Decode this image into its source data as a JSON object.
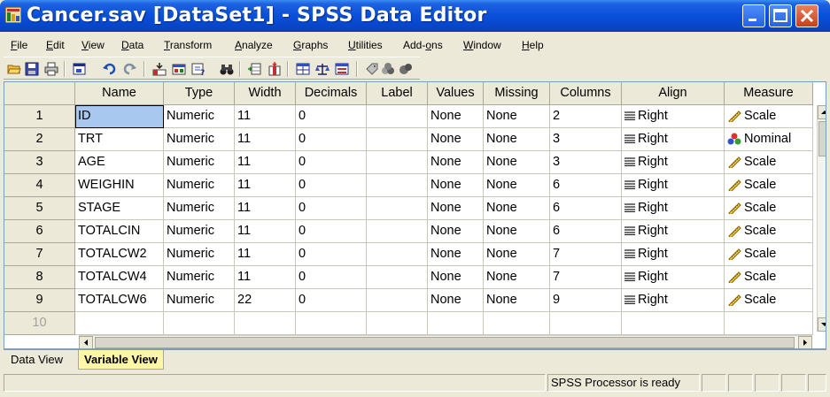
{
  "window": {
    "title": "Cancer.sav [DataSet1] - SPSS Data Editor"
  },
  "menu": [
    "File",
    "Edit",
    "View",
    "Data",
    "Transform",
    "Analyze",
    "Graphs",
    "Utilities",
    "Add-ons",
    "Window",
    "Help"
  ],
  "toolbar_icons": [
    "open-icon",
    "save-icon",
    "print-icon",
    "dialog-recall-icon",
    "undo-icon",
    "redo-icon",
    "goto-case-icon",
    "variables-icon",
    "find-icon",
    "insert-cases-icon",
    "insert-variable-icon",
    "split-file-icon",
    "weight-cases-icon",
    "select-cases-icon",
    "value-labels-icon",
    "use-sets-icon"
  ],
  "grid": {
    "headers": [
      "Name",
      "Type",
      "Width",
      "Decimals",
      "Label",
      "Values",
      "Missing",
      "Columns",
      "Align",
      "Measure"
    ],
    "rows": [
      {
        "num": "1",
        "name": "ID",
        "type": "Numeric",
        "width": "11",
        "decimals": "0",
        "label": "",
        "values": "None",
        "missing": "None",
        "columns": "2",
        "align": "Right",
        "measure": "Scale"
      },
      {
        "num": "2",
        "name": "TRT",
        "type": "Numeric",
        "width": "11",
        "decimals": "0",
        "label": "",
        "values": "None",
        "missing": "None",
        "columns": "3",
        "align": "Right",
        "measure": "Nominal"
      },
      {
        "num": "3",
        "name": "AGE",
        "type": "Numeric",
        "width": "11",
        "decimals": "0",
        "label": "",
        "values": "None",
        "missing": "None",
        "columns": "3",
        "align": "Right",
        "measure": "Scale"
      },
      {
        "num": "4",
        "name": "WEIGHIN",
        "type": "Numeric",
        "width": "11",
        "decimals": "0",
        "label": "",
        "values": "None",
        "missing": "None",
        "columns": "6",
        "align": "Right",
        "measure": "Scale"
      },
      {
        "num": "5",
        "name": "STAGE",
        "type": "Numeric",
        "width": "11",
        "decimals": "0",
        "label": "",
        "values": "None",
        "missing": "None",
        "columns": "6",
        "align": "Right",
        "measure": "Scale"
      },
      {
        "num": "6",
        "name": "TOTALCIN",
        "type": "Numeric",
        "width": "11",
        "decimals": "0",
        "label": "",
        "values": "None",
        "missing": "None",
        "columns": "6",
        "align": "Right",
        "measure": "Scale"
      },
      {
        "num": "7",
        "name": "TOTALCW2",
        "type": "Numeric",
        "width": "11",
        "decimals": "0",
        "label": "",
        "values": "None",
        "missing": "None",
        "columns": "7",
        "align": "Right",
        "measure": "Scale"
      },
      {
        "num": "8",
        "name": "TOTALCW4",
        "type": "Numeric",
        "width": "11",
        "decimals": "0",
        "label": "",
        "values": "None",
        "missing": "None",
        "columns": "7",
        "align": "Right",
        "measure": "Scale"
      },
      {
        "num": "9",
        "name": "TOTALCW6",
        "type": "Numeric",
        "width": "22",
        "decimals": "0",
        "label": "",
        "values": "None",
        "missing": "None",
        "columns": "9",
        "align": "Right",
        "measure": "Scale"
      }
    ],
    "empty_row": "10"
  },
  "tabs": {
    "data_view": "Data View",
    "variable_view": "Variable View"
  },
  "status": {
    "processor": "SPSS  Processor is ready"
  },
  "colors": {
    "titlebar": "#0a4fd9",
    "selected_cell": "#a8c8f0",
    "active_tab": "#fff6a8"
  }
}
